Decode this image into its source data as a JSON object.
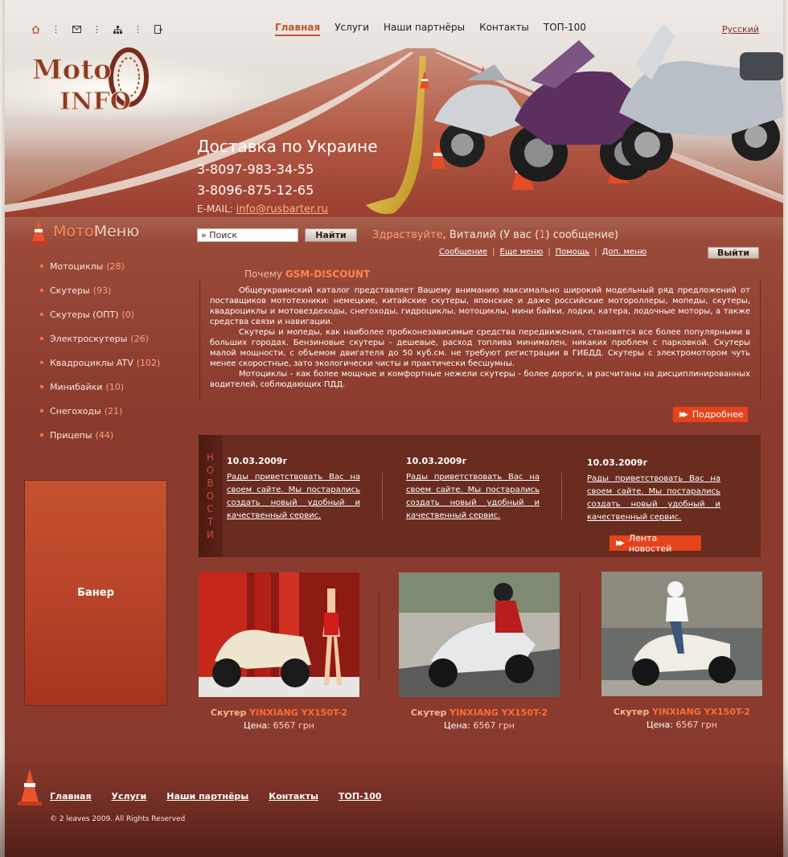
{
  "header": {
    "nav": [
      {
        "label": "Главная",
        "active": true
      },
      {
        "label": "Услуги",
        "active": false
      },
      {
        "label": "Наши партнёры",
        "active": false
      },
      {
        "label": "Контакты",
        "active": false
      },
      {
        "label": "ТОП-100",
        "active": false
      }
    ],
    "language": "Русский",
    "logo_text": "MotoINFO",
    "icons": [
      "home-icon",
      "mail-icon",
      "sitemap-icon",
      "bookmark-icon"
    ],
    "delivery_title": "Доставка по Украине",
    "phones": [
      "3-8097-983-34-55",
      "3-8096-875-12-65"
    ],
    "email_label": "E-MAIL:",
    "email": "info@rusbarter.ru"
  },
  "sidebar": {
    "title_part1": "Мото",
    "title_part2": "Меню",
    "items": [
      {
        "label": "Мотоциклы",
        "count": "(28)"
      },
      {
        "label": "Скутеры",
        "count": "(93)"
      },
      {
        "label": "Скутеры (ОПТ)",
        "count": "(0)"
      },
      {
        "label": "Электроскутеры",
        "count": "(26)"
      },
      {
        "label": "Квадроциклы ATV",
        "count": "(102)"
      },
      {
        "label": "Минибайки",
        "count": "(10)"
      },
      {
        "label": "Снегоходы",
        "count": "(21)"
      },
      {
        "label": "Прицепы",
        "count": "(44)"
      }
    ],
    "banner": "Банер"
  },
  "search": {
    "placeholder": "» Поиск",
    "button": "Найти"
  },
  "user": {
    "greeting": "Здраствуйте",
    "name": ", Виталий (У вас (",
    "msg_count": "1",
    "msg_tail": ") сообщение)",
    "links": [
      "Сообщение",
      "Еще меню",
      "Помощь",
      "Доп. меню"
    ],
    "logout": "Выйти"
  },
  "intro": {
    "why_prefix": "Почему ",
    "why_brand": "GSM-DISCOUNT",
    "paragraphs": [
      "Общеукраинский каталог представляет Вашему вниманию максимально широкий модельный ряд предложений от поставщи­ков мототехники: немецкие, китайские скутеры, японские и даже российские мотороллеры, мопеды, скутеры, квадроциклы и мотовездеходы, снегоходы, гидроциклы, мотоциклы, мини байки, лодки, катера, лодочные моторы, а также средства связи и навигации.",
      "Скутеры и мопеды, как наиболее пробконезависимые средства передвижения, становятся все более популярными в боль­ших городах. Бензиновые скутеры - дешевые, расход топлива минимален, никаких проблем с парковкой. Скутеры малой мощности, с объемом двигателя до 50 куб.см. не требуют регистрации в ГИБДД. Скутеры с электромотором чуть менее скоростные, зато экологически чисты и практически бесшумны.",
      "Мотоциклы - как более мощные и комфортные нежели скутеры - более дороги, и расчитаны на дисциплинированных води­телей, соблюдающих ПДД."
    ],
    "more_button": "Подробнее"
  },
  "news": {
    "side_label": "НОВОСТИ",
    "items": [
      {
        "date": "10.03.2009г",
        "text": "Рады приветствовать Вас на своем сайте. Мы постарались создать новый удобный и каче­ственный сервис."
      },
      {
        "date": "10.03.2009г",
        "text": "Рады приветствовать Вас на своем сайте. Мы постарались создать новый удобный и каче­ственный сервис."
      },
      {
        "date": "10.03.2009г",
        "text": "Рады приветствовать Вас на своем сайте. Мы постарались создать новый удобный и каче­ственный сервис."
      }
    ],
    "feed_button": "Лента новостей"
  },
  "products": [
    {
      "type": "Скутер ",
      "model": "YINXIANG YX150T-2",
      "price_label": "Цена: ",
      "price": "6567 грн"
    },
    {
      "type": "Скутер ",
      "model": "YINXIANG YX150T-2",
      "price_label": "Цена: ",
      "price": "6567 грн"
    },
    {
      "type": "Скутер ",
      "model": "YINXIANG YX150T-2",
      "price_label": "Цена: ",
      "price": "6567 грн"
    }
  ],
  "footer": {
    "nav": [
      "Главная",
      "Услуги",
      "Наши партнёры",
      "Контакты",
      "ТОП-100"
    ],
    "copyright": "© 2 leaves 2009. All Rights Reserved"
  },
  "colors": {
    "accent": "#e5431c",
    "background": "#8a3b2e",
    "link": "#ff9b73"
  }
}
